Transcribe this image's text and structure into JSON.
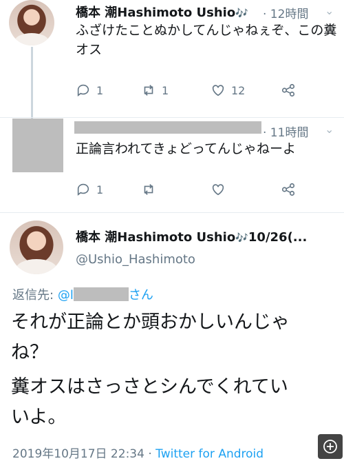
{
  "tweet1": {
    "name": "橋本 潮Hashimoto Ushio",
    "name_emoji": "🎶",
    "time": "· 12時間",
    "text": "ふざけたことぬかしてんじゃねぇぞ、この糞オス",
    "reply_count": "1",
    "retweet_count": "1",
    "like_count": "12"
  },
  "tweet2": {
    "time": "· 11時間",
    "text": "正論言われてきょどってんじゃねーよ",
    "reply_count": "1"
  },
  "tweet3": {
    "name": "橋本 潮Hashimoto Ushio",
    "name_emoji": "🎶",
    "date_trunc": "10/26(...",
    "handle": "@Ushio_Hashimoto",
    "reply_to_label": "返信先:",
    "reply_to_handle": "@l",
    "reply_to_suffix": "さん",
    "text_line1": "それが正論とか頭おかしいんじゃ",
    "text_line2": "ね？",
    "text_line3": "糞オスはさっさとシんでくれてい",
    "text_line4": "いよ。",
    "timestamp": "2019年10月17日 22:34",
    "separator": "·",
    "source": "Twitter for Android"
  },
  "icons": {
    "reply": "reply-icon",
    "retweet": "retweet-icon",
    "like": "heart-icon",
    "share": "share-icon",
    "caret": "chevron-down-icon",
    "zoom": "zoom-in-icon"
  },
  "colors": {
    "text": "#14171a",
    "muted": "#657786",
    "link": "#1da1f2",
    "thread_line": "#ccd6dd"
  }
}
